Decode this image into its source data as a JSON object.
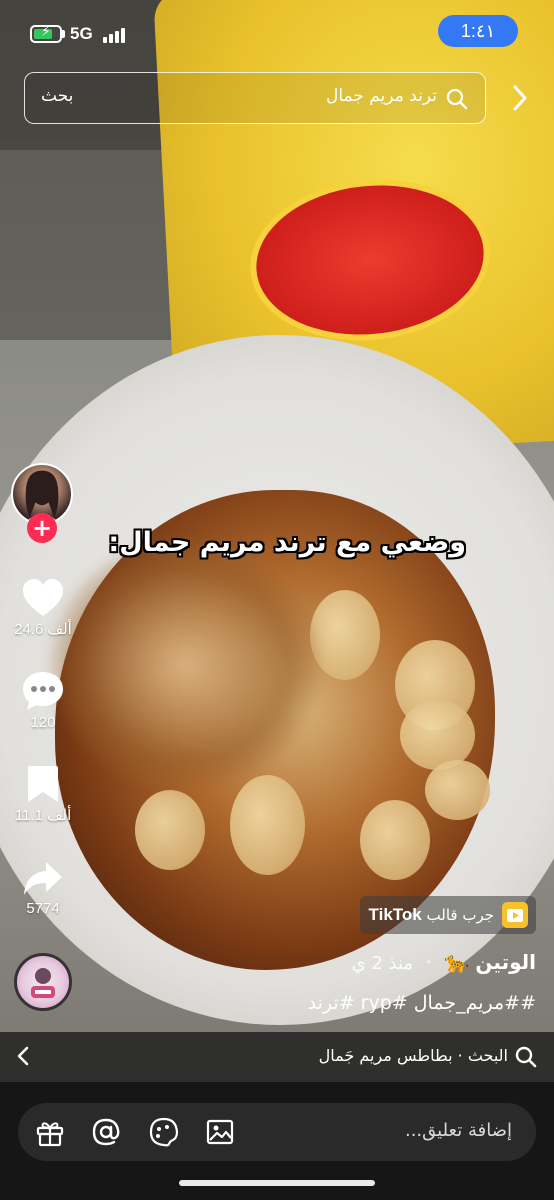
{
  "status_bar": {
    "time": "1:٤١",
    "network": "5G",
    "battery_level": 0.75
  },
  "search": {
    "query": "ترند مريم جمال",
    "submit_label": "بحث"
  },
  "caption": "وضعي مع ترند مريم جمال:",
  "actions": {
    "likes": "24.6 ألف",
    "comments": "120",
    "saves": "11.1 ألف",
    "shares": "5774"
  },
  "template_badge": {
    "prefix": "جرب قالب",
    "brand": "TikTok"
  },
  "author": {
    "name": "الوتين",
    "emoji": "🐆",
    "separator": "·",
    "time_ago": "منذ 2 ي"
  },
  "hashtags": "##مريم_جمال #ryp #ترند",
  "related_search": {
    "label": "البحث",
    "separator": "·",
    "query": "بطاطس مريم جَمال"
  },
  "comment_bar": {
    "placeholder": "إضافة تعليق..."
  },
  "colors": {
    "accent_blue": "#3478f6",
    "follow_red": "#fe2c55",
    "battery_green": "#34c759",
    "template_yellow": "#f6c22c"
  },
  "icons": [
    "battery-icon",
    "signal-icon",
    "chevron-right-icon",
    "search-icon",
    "plus-icon",
    "heart-icon",
    "comment-icon",
    "bookmark-icon",
    "share-icon",
    "template-icon",
    "music-disc-icon",
    "chevron-left-icon",
    "gift-icon",
    "mention-icon",
    "emoji-icon",
    "image-icon"
  ]
}
